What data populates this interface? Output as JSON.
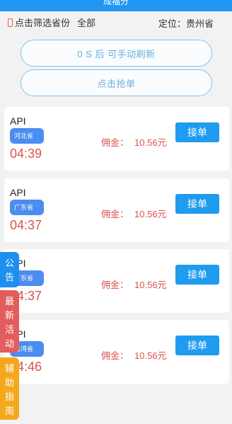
{
  "header": {
    "title": "成福分"
  },
  "filter": {
    "label": "点击筛选省份",
    "value": "全部",
    "location": "定位：贵州省"
  },
  "buttons": {
    "refresh": "0 S 后 可手动刷新",
    "grab": "点击抢单"
  },
  "orders": [
    {
      "name": "API",
      "province": "河北省",
      "time": "04:39",
      "commission_label": "佣金：",
      "commission_value": "10.56元",
      "action": "接单"
    },
    {
      "name": "API",
      "province": "广东省",
      "time": "04:37",
      "commission_label": "佣金：",
      "commission_value": "10.56元",
      "action": "接单"
    },
    {
      "name": "API",
      "province": "广东省",
      "time": "04:37",
      "commission_label": "佣金：",
      "commission_value": "10.56元",
      "action": "接单"
    },
    {
      "name": "API",
      "province": "台湾省",
      "time": "04:46",
      "commission_label": "佣金：",
      "commission_value": "10.56元",
      "action": "接单"
    }
  ],
  "side_tabs": {
    "notice": "公\n告",
    "events": "最\n新\n活\n动",
    "guide": "辅\n助\n指\n南"
  },
  "colors": {
    "primary": "#1f9bf0",
    "price": "#d9534f",
    "notice": "#1f8fef",
    "events": "#e45d5d",
    "guide": "#f5a81e"
  },
  "icons": {
    "filter": "phone-icon"
  }
}
